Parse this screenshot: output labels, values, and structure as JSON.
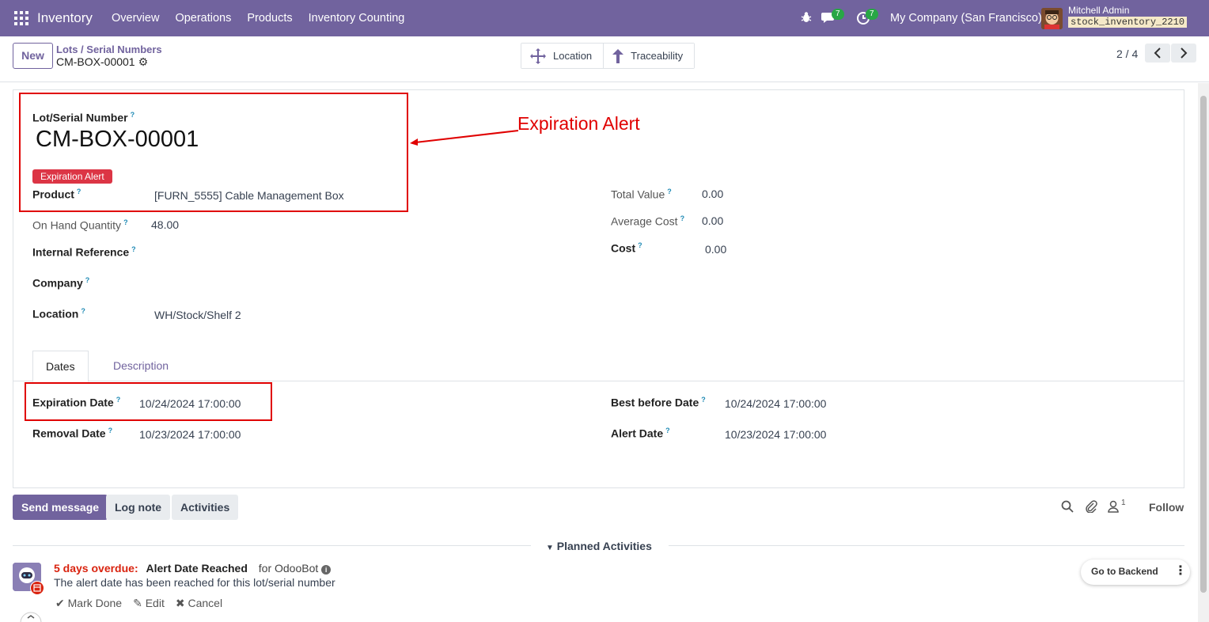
{
  "navbar": {
    "app_name": "Inventory",
    "menu": [
      "Overview",
      "Operations",
      "Products",
      "Inventory Counting"
    ],
    "chat_count": "7",
    "activity_count": "7",
    "company": "My Company (San Francisco)",
    "user_name": "Mitchell Admin",
    "database": "stock_inventory_2210"
  },
  "control": {
    "new_label": "New",
    "breadcrumb": "Lots / Serial Numbers",
    "record_name": "CM-BOX-00001",
    "smart_buttons": [
      {
        "label": "Location",
        "icon": "arrows-move-icon"
      },
      {
        "label": "Traceability",
        "icon": "arrow-up-icon"
      }
    ],
    "pager": "2 / 4"
  },
  "form": {
    "lot_label": "Lot/Serial Number",
    "lot_name": "CM-BOX-00001",
    "tag": "Expiration Alert",
    "product_label": "Product",
    "product_value": "[FURN_5555] Cable Management Box",
    "qty_label": "On Hand Quantity",
    "qty_value": "48.00",
    "ref_label": "Internal Reference",
    "company_label": "Company",
    "location_label": "Location",
    "location_value": "WH/Stock/Shelf 2",
    "total_value_label": "Total Value",
    "total_value": "0.00",
    "avg_cost_label": "Average Cost",
    "avg_cost": "0.00",
    "cost_label": "Cost",
    "cost": "0.00",
    "help_mark": "?"
  },
  "tabs": [
    "Dates",
    "Description"
  ],
  "dates": {
    "expiration_label": "Expiration Date",
    "expiration_value": "10/24/2024 17:00:00",
    "removal_label": "Removal Date",
    "removal_value": "10/23/2024 17:00:00",
    "best_before_label": "Best before Date",
    "best_before_value": "10/24/2024 17:00:00",
    "alert_label": "Alert Date",
    "alert_value": "10/23/2024 17:00:00"
  },
  "annotation": "Expiration Alert",
  "annotation_color": "#e00000",
  "chatter": {
    "send_message": "Send message",
    "log_note": "Log note",
    "activities": "Activities",
    "follower_count": "1",
    "follow": "Follow",
    "planned_activities": "Planned Activities"
  },
  "activity": {
    "overdue": "5 days overdue:",
    "title": "Alert Date Reached",
    "for_text": "for OdooBot",
    "description": "The alert date has been reached for this lot/serial number",
    "mark_done": "Mark Done",
    "edit": "Edit",
    "cancel": "Cancel"
  },
  "go_backend": "Go to Backend",
  "colors": {
    "brand": "#71639e",
    "danger": "#dc3545",
    "success": "#28a745"
  }
}
